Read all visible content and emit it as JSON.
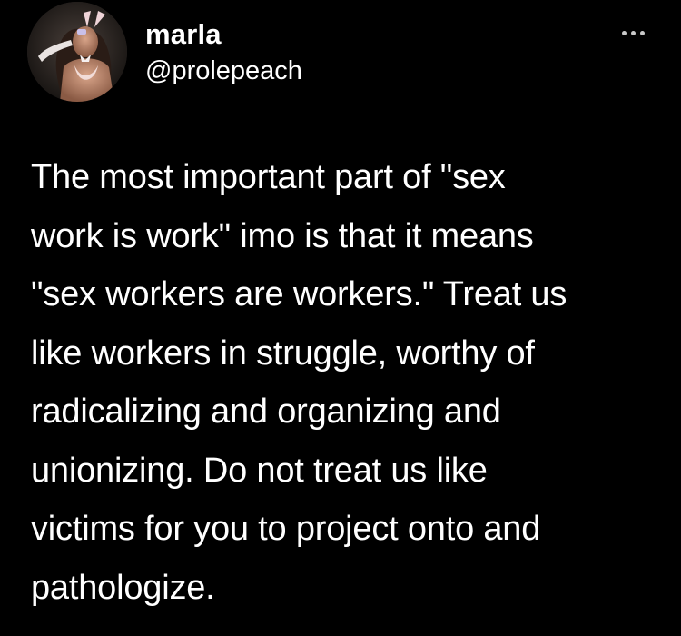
{
  "tweet": {
    "author": {
      "display_name": "marla",
      "handle": "@prolepeach",
      "avatar_icon": "profile-photo"
    },
    "more_icon": "more-options-icon",
    "text_lines": [
      "The most important part of \"sex",
      "work is work\" imo is that it means",
      "\"sex workers are workers.\" Treat us",
      "like workers in struggle, worthy of",
      "radicalizing and organizing and",
      "unionizing. Do not treat us like",
      "victims for you to project onto and",
      "pathologize."
    ]
  },
  "colors": {
    "background": "#000000",
    "text": "#ffffff",
    "more_dots": "#c9c9c9"
  }
}
